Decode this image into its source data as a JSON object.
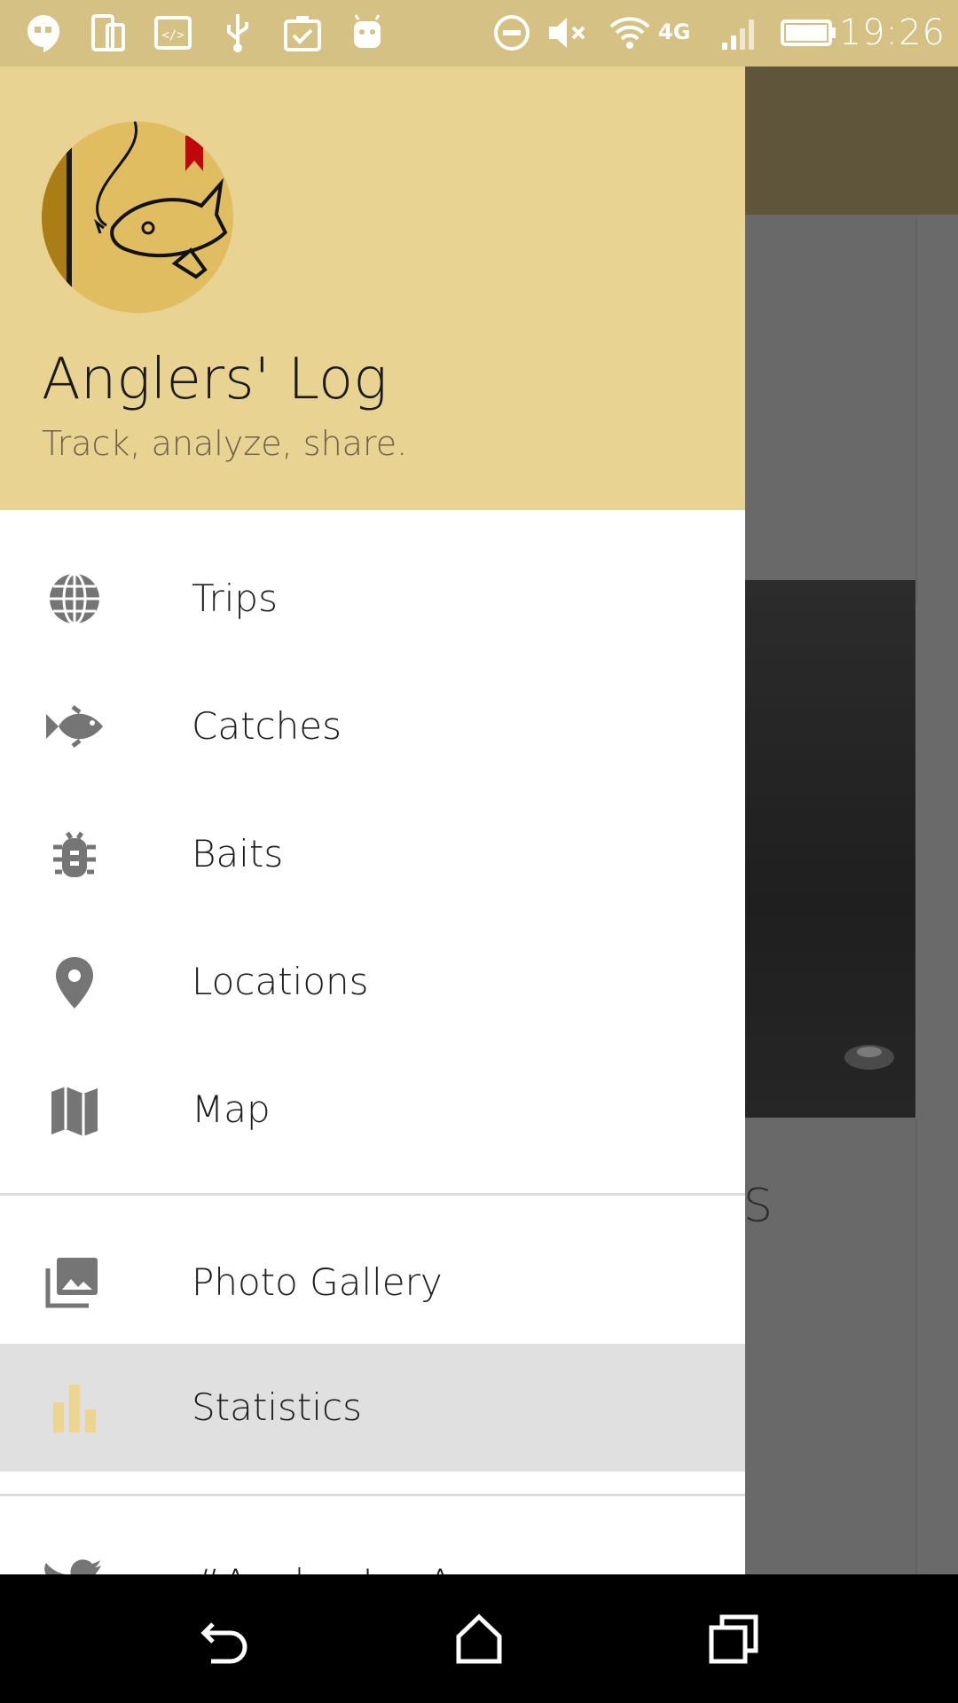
{
  "status_bar": {
    "time": "19:26",
    "network": "4G",
    "icons": [
      "hangouts-icon",
      "device-icon",
      "code-icon",
      "usb-icon",
      "clipboard-check-icon",
      "android-icon",
      "do-not-disturb-icon",
      "mute-icon",
      "wifi-icon",
      "signal-icon",
      "battery-icon"
    ]
  },
  "drawer": {
    "header": {
      "title": "Anglers' Log",
      "subtitle": "Track, analyze, share."
    },
    "items": [
      {
        "label": "Trips",
        "icon": "globe-icon"
      },
      {
        "label": "Catches",
        "icon": "fish-icon"
      },
      {
        "label": "Baits",
        "icon": "bug-icon"
      },
      {
        "label": "Locations",
        "icon": "location-pin-icon"
      },
      {
        "label": "Map",
        "icon": "map-icon"
      },
      {
        "label": "Photo Gallery",
        "icon": "photo-gallery-icon"
      },
      {
        "label": "Statistics",
        "icon": "bar-chart-icon",
        "selected": true
      },
      {
        "label": "#AnglersLogApp",
        "icon": "twitter-icon"
      }
    ],
    "accent_color": "#e9d393",
    "selected_icon_color": "#ecd58e"
  },
  "background_app": {
    "partial_text": "S"
  },
  "nav_bar": {
    "buttons": [
      "back-icon",
      "home-icon",
      "recents-icon"
    ]
  }
}
